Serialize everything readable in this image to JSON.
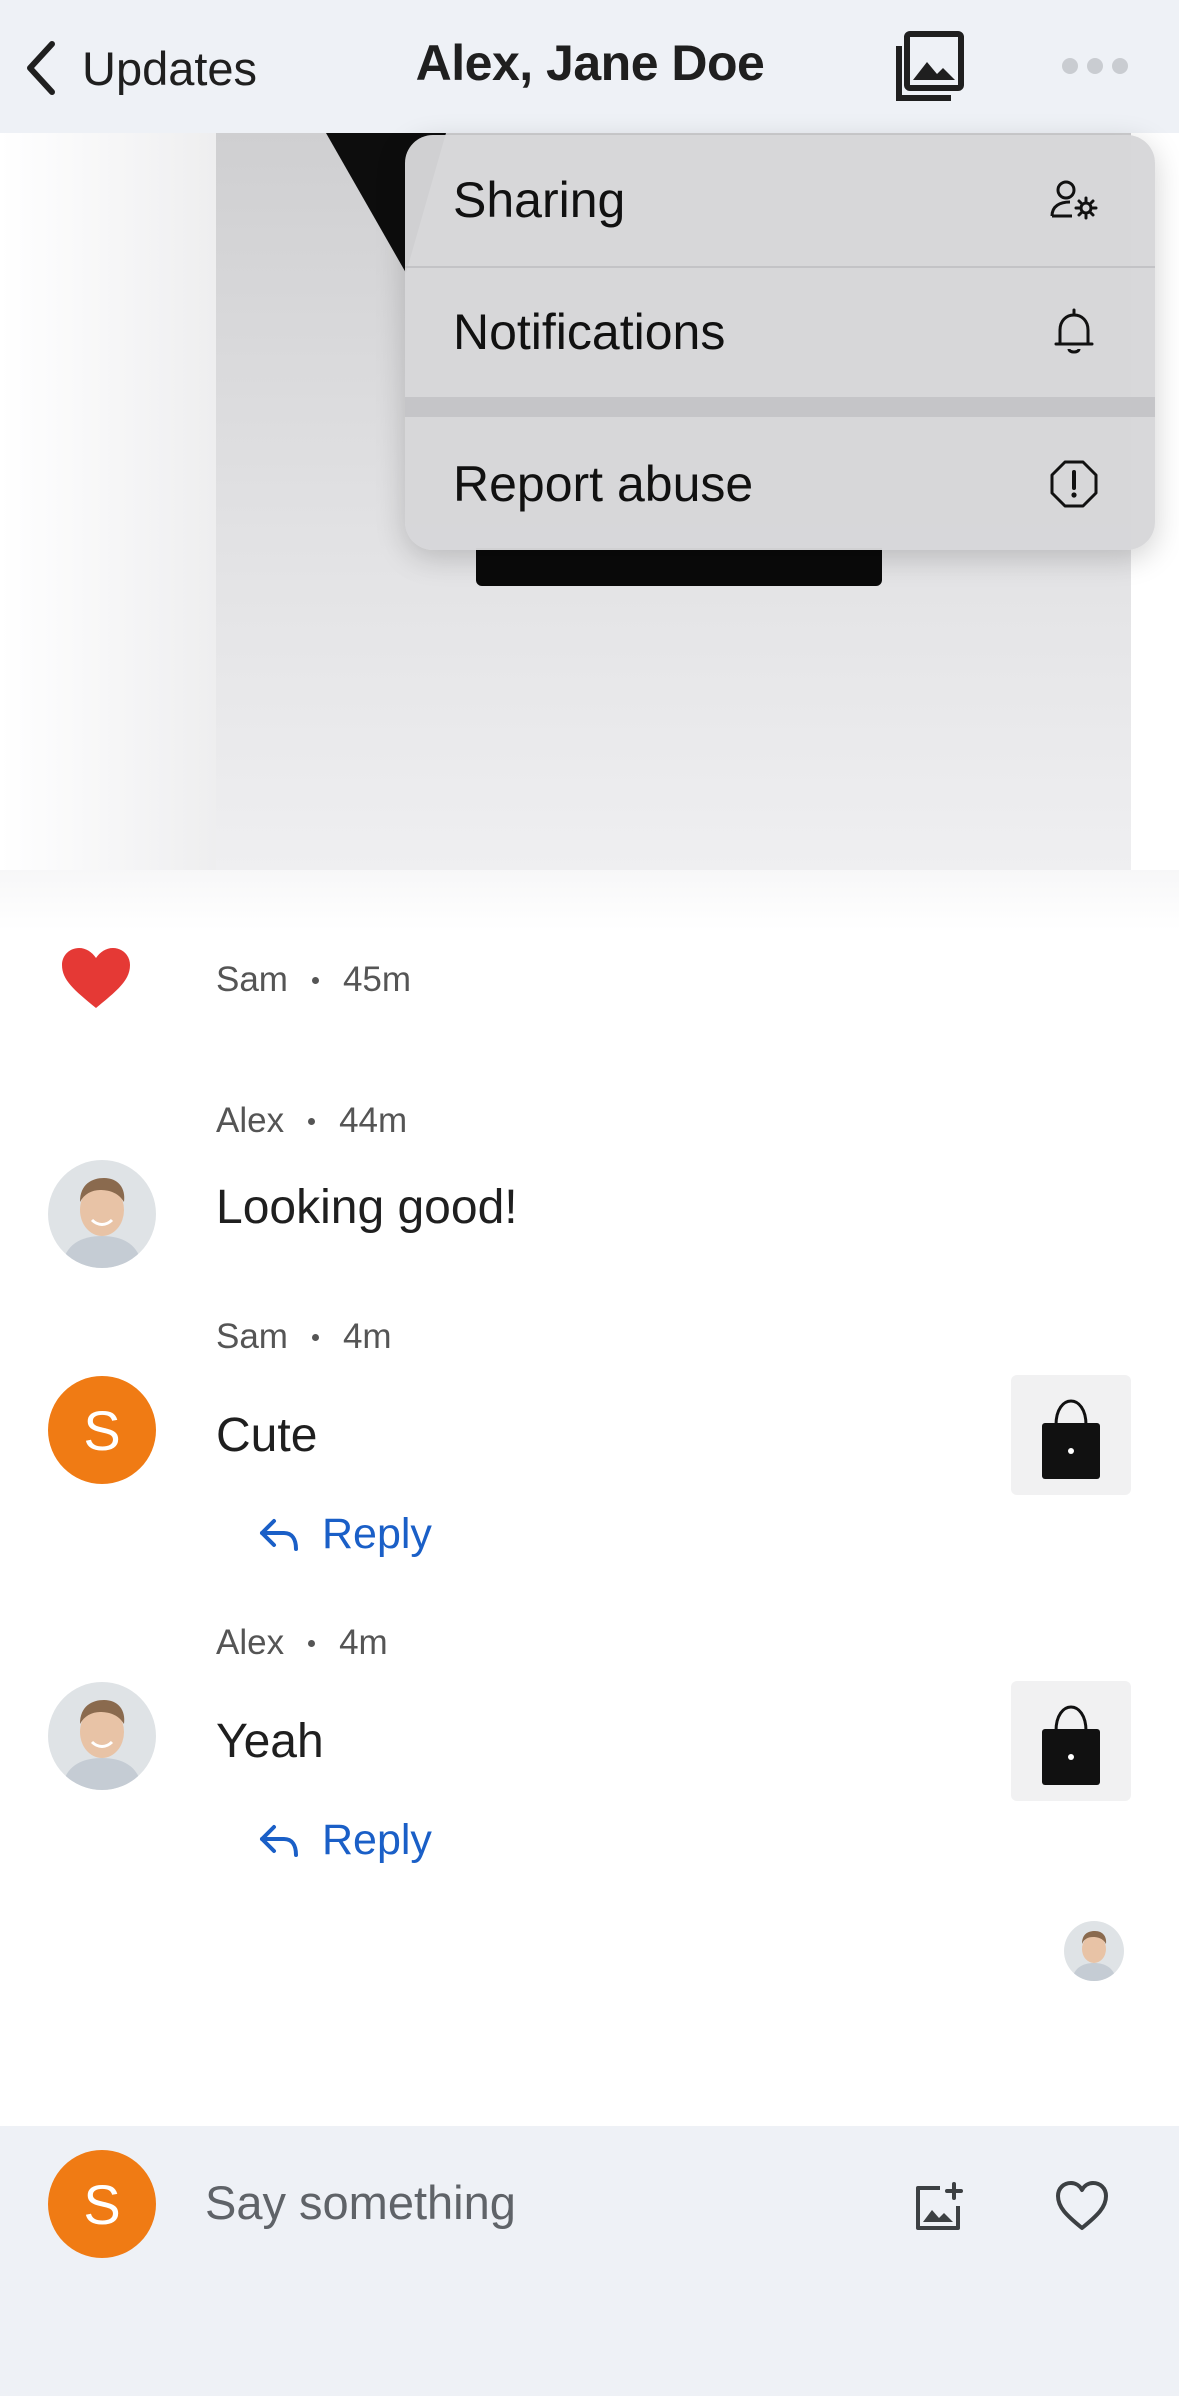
{
  "header": {
    "back_label": "Updates",
    "title": "Alex, Jane Doe",
    "album_icon": "photo-album-icon",
    "more_icon": "more-horizontal-icon"
  },
  "menu": {
    "items": [
      {
        "label": "Sharing",
        "icon": "person-settings-icon"
      },
      {
        "label": "Notifications",
        "icon": "bell-icon"
      },
      {
        "label": "Report abuse",
        "icon": "alert-octagon-icon"
      }
    ]
  },
  "feed": {
    "like": {
      "author": "Sam",
      "time": "45m",
      "icon": "heart-filled-icon",
      "color": "#e53935"
    },
    "comments": [
      {
        "author": "Alex",
        "time": "44m",
        "text": "Looking good!",
        "avatar": "photo"
      },
      {
        "author": "Sam",
        "time": "4m",
        "text": "Cute",
        "avatar_letter": "S",
        "reply_label": "Reply",
        "has_thumbnail": true
      },
      {
        "author": "Alex",
        "time": "4m",
        "text": "Yeah",
        "avatar": "photo",
        "reply_label": "Reply",
        "has_thumbnail": true
      }
    ]
  },
  "composer": {
    "avatar_letter": "S",
    "placeholder": "Say something",
    "add_photo_icon": "add-photo-icon",
    "heart_icon": "heart-outline-icon"
  },
  "colors": {
    "accent_link": "#1a5fc7",
    "avatar_orange": "#f07b14",
    "header_bg": "#eef1f6"
  }
}
